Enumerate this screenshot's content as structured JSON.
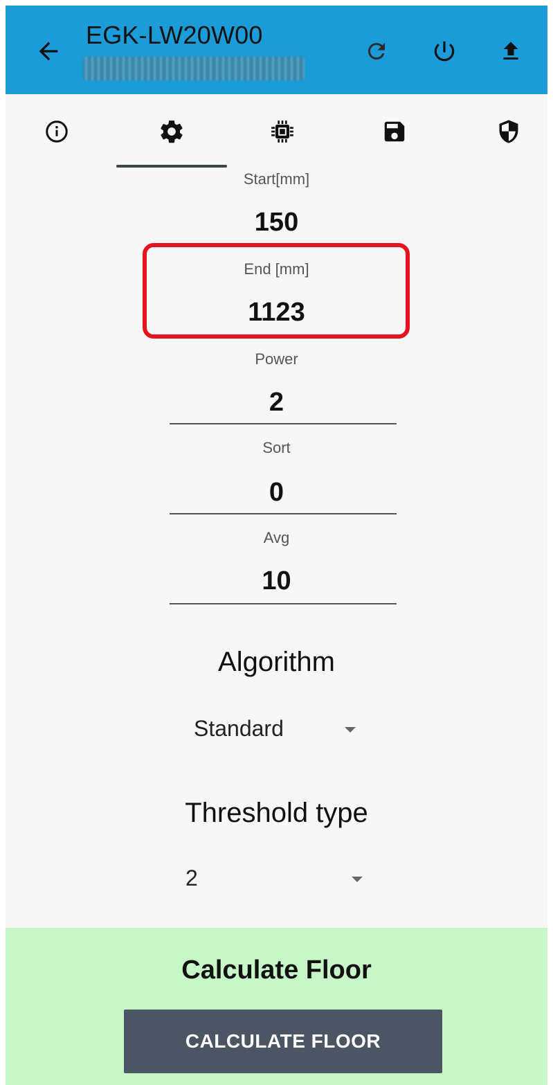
{
  "header": {
    "title": "EGK-LW20W00",
    "subtitle": "",
    "icons": [
      "arrow-back-icon",
      "refresh-icon",
      "power-icon",
      "upload-icon"
    ],
    "bar_color": "#1b9bd8"
  },
  "tabs": [
    {
      "icon": "info-icon"
    },
    {
      "icon": "gear-icon",
      "selected": true
    },
    {
      "icon": "chip-icon"
    },
    {
      "icon": "save-icon"
    },
    {
      "icon": "shield-icon"
    }
  ],
  "fields": {
    "start": {
      "label": "Start[mm]",
      "value": "150"
    },
    "end": {
      "label": "End [mm]",
      "value": "1123",
      "highlight_color": "#e3141d"
    },
    "power": {
      "label": "Power",
      "value": "2"
    },
    "sort": {
      "label": "Sort",
      "value": "0"
    },
    "avg": {
      "label": "Avg",
      "value": "10"
    }
  },
  "algorithm": {
    "title": "Algorithm",
    "selected": "Standard"
  },
  "threshold": {
    "title": "Threshold type",
    "selected": "2"
  },
  "footer": {
    "title": "Calculate Floor",
    "button_label": "CALCULATE FLOOR",
    "background": "#c7f7c7",
    "button_color": "#4b5563"
  }
}
